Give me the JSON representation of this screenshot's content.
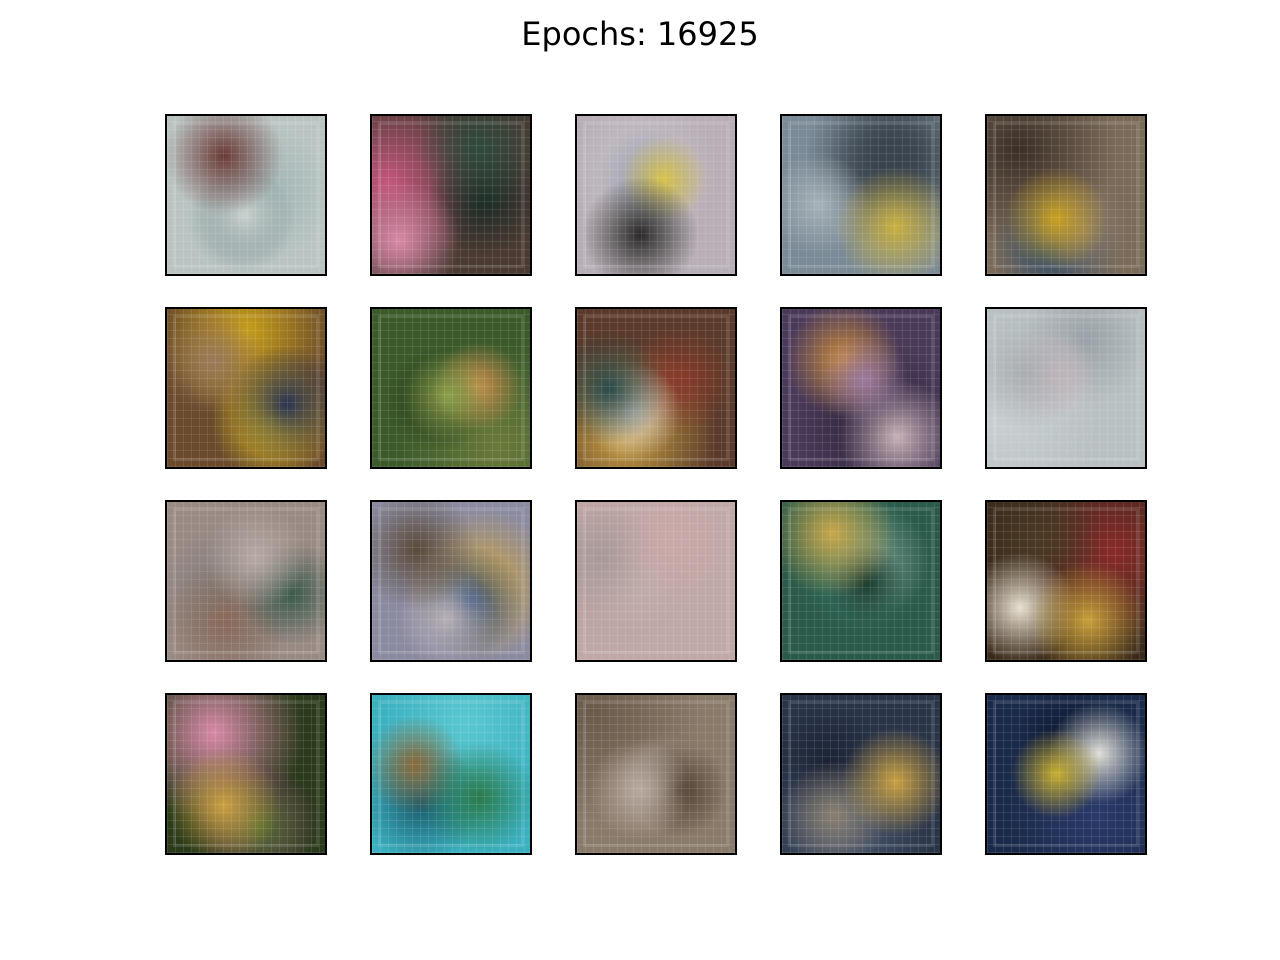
{
  "figure": {
    "title": "Epochs: 16925"
  },
  "grid": {
    "rows": 4,
    "cols": 5,
    "samples": [
      {
        "colors": [
          "#b9c4c2",
          "#9fb3b4",
          "#6a3a36",
          "#c9d2cf",
          "#7d8f92"
        ]
      },
      {
        "colors": [
          "#4a3a32",
          "#c4567c",
          "#2e4a3c",
          "#d88aa8",
          "#1a2a24"
        ]
      },
      {
        "colors": [
          "#b8aeb6",
          "#c7c0c6",
          "#2a2a28",
          "#d8c24a",
          "#8f9ab0"
        ]
      },
      {
        "colors": [
          "#7a8a96",
          "#2a3038",
          "#c9b040",
          "#a7b2b8",
          "#3a4550"
        ]
      },
      {
        "colors": [
          "#7a6a58",
          "#3a2e26",
          "#c9a020",
          "#8a7a6a",
          "#2a4a6a"
        ]
      },
      {
        "colors": [
          "#6a4a2a",
          "#c9a018",
          "#2a3450",
          "#9a7a5a",
          "#e0c020"
        ]
      },
      {
        "colors": [
          "#3a5a2a",
          "#6a7a3a",
          "#8aa04a",
          "#c98a4a",
          "#2a3a1a"
        ]
      },
      {
        "colors": [
          "#5a3a2a",
          "#c9a040",
          "#2a4a4a",
          "#d8d0c8",
          "#8a3a2a"
        ]
      },
      {
        "colors": [
          "#4a3a5a",
          "#2a2238",
          "#9a7aa0",
          "#c9b0b8",
          "#c98a3a"
        ]
      },
      {
        "colors": [
          "#b8c0c2",
          "#c9d0d2",
          "#a8aeb2",
          "#d0b8c0",
          "#9aa2a8"
        ]
      },
      {
        "colors": [
          "#9a8a84",
          "#7a7a7a",
          "#b8aaa4",
          "#3a5a4a",
          "#8a6a5a"
        ]
      },
      {
        "colors": [
          "#8a8aa0",
          "#c9a040",
          "#5a4a3a",
          "#b8b0b8",
          "#2a4a7a"
        ]
      },
      {
        "colors": [
          "#c0a8a6",
          "#b8a0a0",
          "#caa8a8",
          "#a89a98",
          "#c4b0ae"
        ]
      },
      {
        "colors": [
          "#2a5a4a",
          "#3a7a6a",
          "#c9a84a",
          "#1a3a2e",
          "#6a8a7a"
        ]
      },
      {
        "colors": [
          "#3a2a1a",
          "#8a2a2a",
          "#c9a03a",
          "#e8e0d0",
          "#4a3a24"
        ]
      },
      {
        "colors": [
          "#2a3a1a",
          "#d88aa8",
          "#c9a040",
          "#4a6a2a",
          "#7a3a6a"
        ]
      },
      {
        "colors": [
          "#3ab0c0",
          "#5ac8d0",
          "#2a7a4a",
          "#8a6a3a",
          "#1a5a6a"
        ]
      },
      {
        "colors": [
          "#8a7a6a",
          "#6a5a4a",
          "#b8aaa0",
          "#4a3a2a",
          "#a09488"
        ]
      },
      {
        "colors": [
          "#2a3448",
          "#4a5870",
          "#c9a040",
          "#8a8070",
          "#1a2234"
        ]
      },
      {
        "colors": [
          "#1a2a4a",
          "#2a3a6a",
          "#c9b030",
          "#e0e0d8",
          "#0e1830"
        ]
      }
    ]
  }
}
